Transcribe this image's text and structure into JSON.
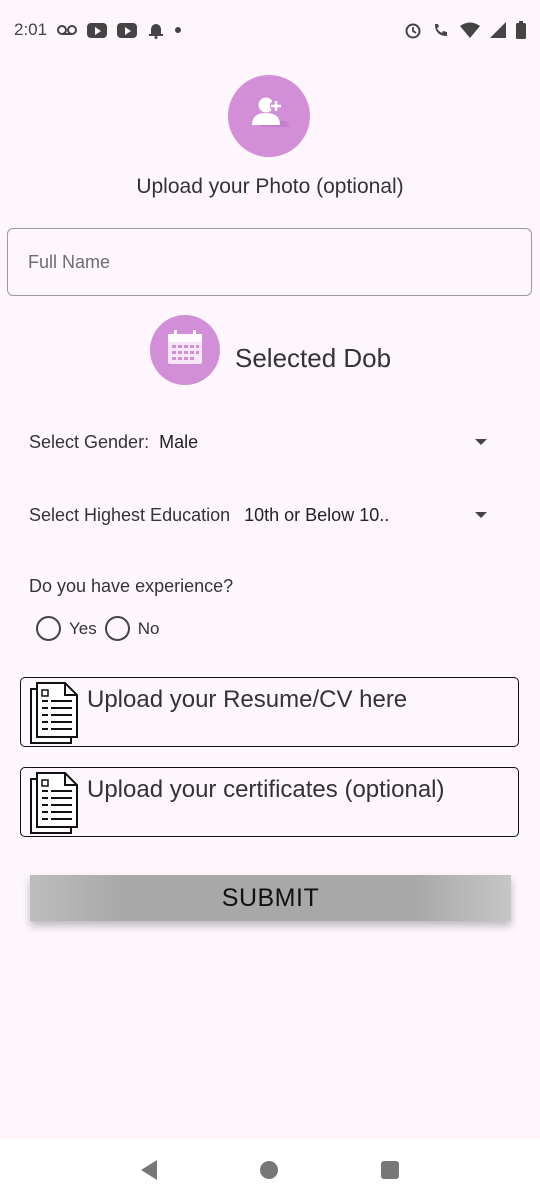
{
  "status_bar": {
    "time": "2:01",
    "icons_left": [
      "voicemail-icon",
      "youtube-icon",
      "youtube-icon",
      "notification-bell-icon",
      "dot-icon"
    ],
    "icons_right": [
      "alarm-icon",
      "wifi-calling-icon",
      "wifi-icon",
      "signal-icon",
      "battery-icon"
    ]
  },
  "photo": {
    "label": "Upload your Photo (optional)",
    "icon": "add-person-icon"
  },
  "full_name": {
    "placeholder": "Full Name",
    "value": ""
  },
  "dob": {
    "label": "Selected Dob",
    "icon": "calendar-icon"
  },
  "gender": {
    "label": "Select Gender:",
    "value": "Male"
  },
  "education": {
    "label": "Select Highest Education",
    "value": "10th or Below 10.."
  },
  "experience": {
    "question": "Do you have experience?",
    "options": [
      "Yes",
      "No"
    ]
  },
  "uploads": {
    "resume_label": "Upload your Resume/CV here",
    "certificates_label": "Upload your certificates (optional)"
  },
  "submit": {
    "label": "SUBMIT"
  },
  "colors": {
    "accent": "#d28ed6",
    "background": "#fdf7fd"
  }
}
